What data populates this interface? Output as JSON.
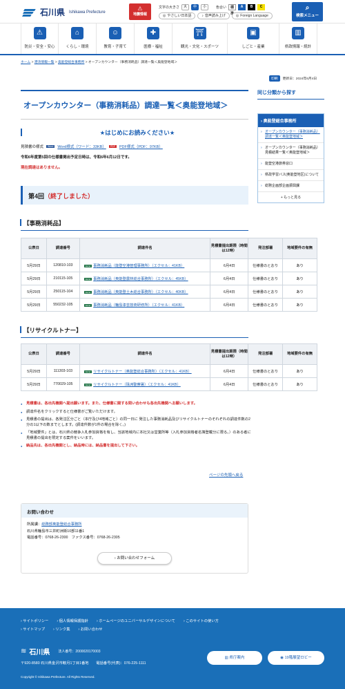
{
  "header": {
    "logo_ja": "石川県",
    "logo_en": "Ishikawa Prefecture",
    "disaster_label": "地震情報",
    "font_size_label": "文字の大きさ",
    "font_sizes": [
      "大",
      "中",
      "小"
    ],
    "color_label": "色合い",
    "colors": [
      "標準",
      "A",
      "B",
      "C"
    ],
    "easy_japanese": "やさしい日本語",
    "voice": "音声読み上げ",
    "foreign": "Foreign Language",
    "search": "検索メニュー"
  },
  "gnav": [
    "防災・安全・安心",
    "くらし・環境",
    "教育・子育て",
    "医療・福祉",
    "観光・文化・スポーツ",
    "しごと・産業",
    "県政情報・統計"
  ],
  "breadcrumb": [
    "ホーム",
    "港湾情報一覧",
    "奥能登総合事務所",
    "オープンカウンター（事務消耗品）調達一覧＜奥能登地域＞"
  ],
  "updated": {
    "print": "印刷",
    "text": "更新日：2024年6月4日"
  },
  "title": "オープンカウンター（事務消耗品）調達一覧＜奥能登地域＞",
  "readme": "★はじめにお読みください★",
  "mitsumori": {
    "label": "見積書の様式",
    "word": "Word様式（ワード：33KB）",
    "pdf": "PDF様式（PDF：97KB）",
    "word_tag": "Word",
    "pdf_tag": "PDF"
  },
  "notice": "令和6年度第5回の仕様書掲出予定日時は、令和6年6月12日です。",
  "none": "現在調達はありません。",
  "round": {
    "prefix": "第4回",
    "status": "（終了しました）"
  },
  "sections": {
    "office": "【事務消耗品】",
    "toner": "【リサイクルトナー】"
  },
  "table_headers": [
    "公表日",
    "調達番号",
    "調達件名",
    "見積書提出期限（時間は12時）",
    "発注部署",
    "地域要件の有無"
  ],
  "office_rows": [
    [
      "5月29日",
      "120810-103",
      "事務消耗品（能登空港管理事務所）（エクセル：41KB）",
      "6月4日",
      "仕様書のとおり",
      "あり"
    ],
    [
      "5月29日",
      "210115-105",
      "事務消耗品（奥能登農林総合事務所）（エクセル：45KB）",
      "6月4日",
      "仕様書のとおり",
      "あり"
    ],
    [
      "5月29日",
      "250115-104",
      "事務消耗品（奥能登土木総合事務所）（エクセル：40KB）",
      "6月4日",
      "仕様書のとおり",
      "あり"
    ],
    [
      "5月29日",
      "550232-105",
      "事務消耗品（輪島漆芸技術研修所）（エクセル：41KB）",
      "6月4日",
      "仕様書のとおり",
      "あり"
    ]
  ],
  "toner_rows": [
    [
      "5月29日",
      "111303-103",
      "リサイクルトナー（奥能登総合事務所）（エクセル：41KB）",
      "6月4日",
      "仕様書のとおり",
      "あり"
    ],
    [
      "5月29日",
      "770029-105",
      "リサイクルトナー（珠洲警察署）（エクセル：41KB）",
      "6月4日",
      "仕様書のとおり",
      "あり"
    ]
  ],
  "excel_tag": "Excel",
  "bullets": [
    "見積書は、各出先機関へ提出願います。また、仕様書に関する問い合わせも各出先機関へお願いします。",
    "調達件名をクリックすると仕様書がご覧いただけます。",
    "見積書の提出は、各発注区分ごと（本庁及び4地域ごと）の同一日に 発注した事務消耗品及びリサイクルトナーのそれぞれの調達件数の2分の1以下の数までとします。(調達件数が1件の場合を除く。)",
    "「地域要件」とは、石川県の競争入札参加資格を有し、当該地域内に本社又は営業所等（入札参加資格者名簿登載分に限る。）のある者に見積書の提出を限定する案件をいいます。",
    "納品先は、各出先機関とし、納品時には、納品書を提出して下さい。"
  ],
  "pagetop": "ページの先頭へ戻る",
  "inquiry": {
    "head": "お問い合わせ",
    "dept_label": "所属課：",
    "dept": "総務部奥能登総合事務所",
    "addr": "石川県輪島市三井町洲衛10部11番1",
    "tel": "電話番号：0768-26-2300　ファクス番号：0768-26-2305",
    "form": "お問い合わせフォーム"
  },
  "side": {
    "title": "同じ分類から探す",
    "head": "奥能登総合事務所",
    "items": [
      "オープンカウンター（事務消耗品）調達一覧＜奥能登地域＞",
      "オープンカウンター（事務消耗品）見積結果一覧＜奥能登地域＞",
      "能登空港旅券窓口",
      "県政学習バス(奥能登地区)について",
      "総務企画部企画振興課"
    ],
    "more": "もっと見る"
  },
  "footer": {
    "links": [
      "サイトポリシー",
      "個人情報保護指針",
      "ホームページのユニバーサルデザインについて",
      "このサイトの使い方",
      "サイトマップ",
      "リンク集",
      "お問い合わせ"
    ],
    "name": "石川県",
    "corp": "法人番号：2000020170003",
    "addr": "〒920-8580 石川県金沢市鞍月1丁目1番地　　電話番号(代表)：076-225-1111",
    "copy": "Copyright © Ishikawa Prefecture. All Rights Reserved.",
    "access": "県庁案内",
    "floor": "19階展望ロビー"
  }
}
